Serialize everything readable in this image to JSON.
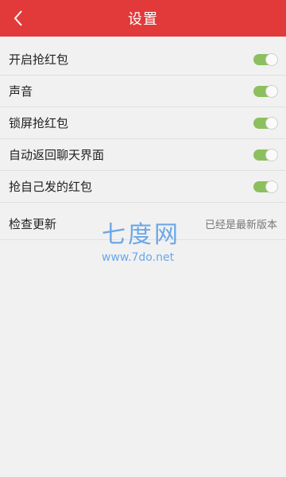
{
  "header": {
    "title": "设置",
    "back_icon": "chevron-left-icon",
    "background_color": "#e23a3a"
  },
  "settings": [
    {
      "label": "开启抢红包",
      "enabled": true
    },
    {
      "label": "声音",
      "enabled": true
    },
    {
      "label": "锁屏抢红包",
      "enabled": true
    },
    {
      "label": "自动返回聊天界面",
      "enabled": true
    },
    {
      "label": "抢自己发的红包",
      "enabled": true
    }
  ],
  "update": {
    "label": "检查更新",
    "status": "已经是最新版本"
  },
  "watermark": {
    "logo_text": "七度网",
    "url": "www.7do.net"
  },
  "colors": {
    "toggle_on": "#8cbf5e",
    "background": "#f1f1f1"
  }
}
